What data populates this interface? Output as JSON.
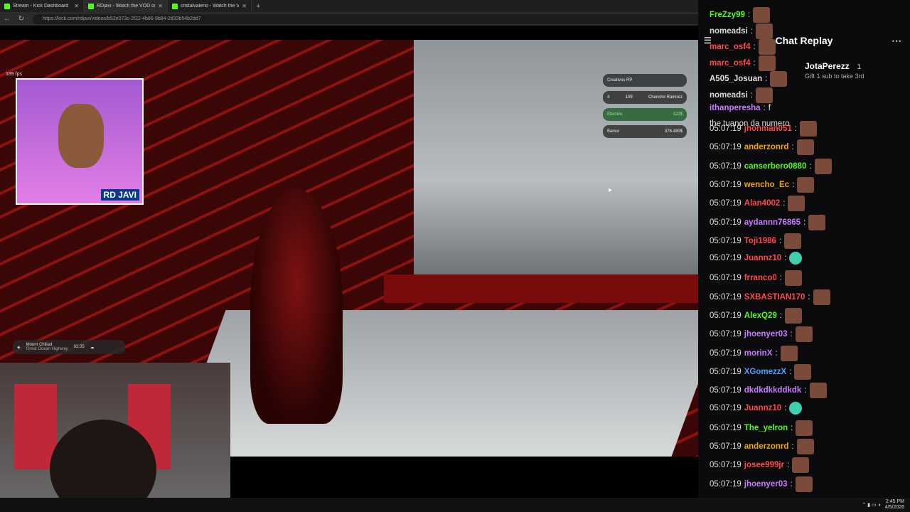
{
  "browser": {
    "tabs": [
      {
        "label": "Stream - Kick Dashboard"
      },
      {
        "label": "RDjavi - Watch the VOD on K"
      },
      {
        "label": "cristalvalerio - Watch the VOD on"
      }
    ],
    "url": "https://kick.com/rdjavi/videos/b52e073c-2f22-4b86-9b84-2d33b54b2dd7"
  },
  "game": {
    "fps": "189 fps",
    "streamer_name": "RD JAVI",
    "hud": {
      "server": "Creativos RP",
      "level": "4",
      "player_id": "109",
      "player_name": "Chencho Ramirez",
      "cash_label": "Efectivo",
      "cash_value": "122$",
      "bank_label": "Banco",
      "bank_value": "376.480$"
    },
    "location": "Mount Chiliad",
    "location_sub": "Great Ocean Highway",
    "time": "02:35"
  },
  "chat": {
    "title": "Chat Replay",
    "gift_user": "JotaPerezz",
    "gift_count": "1",
    "gift_text": "Gift 1 sub to take 3rd",
    "overlay_messages": [
      {
        "user": "FreZzy99",
        "color": "#53fc18"
      },
      {
        "user": "nomeadsi",
        "color": "#d8d8d8"
      },
      {
        "user": "marc_osf4",
        "color": "#ff4a4a"
      },
      {
        "user": "marc_osf4",
        "color": "#ff4a4a"
      },
      {
        "user": "A505_Josuan",
        "color": "#e0e0e0"
      },
      {
        "user": "nomeadsi",
        "color": "#d8d8d8"
      },
      {
        "user": "ithanperesha",
        "color": "#c77dff",
        "text": "f"
      },
      {
        "user": "",
        "color": "#ddd",
        "text": "the tuanon da numero"
      }
    ],
    "messages": [
      {
        "time": "05:07:19",
        "user": "jhonman051",
        "color": "#ff4a4a",
        "text": ""
      },
      {
        "time": "05:07:19",
        "user": "anderzonrd",
        "color": "#f0a500",
        "text": ""
      },
      {
        "time": "05:07:19",
        "user": "canserbero0880",
        "color": "#53fc18",
        "text": ""
      },
      {
        "time": "05:07:19",
        "user": "wencho_Ec",
        "color": "#f0a500",
        "text": ""
      },
      {
        "time": "05:07:19",
        "user": "Alan4002",
        "color": "#ff4a4a",
        "text": ""
      },
      {
        "time": "05:07:19",
        "user": "aydannn76865",
        "color": "#c77dff",
        "text": ""
      },
      {
        "time": "05:07:19",
        "user": "Toji1986",
        "color": "#ff4a4a",
        "text": ""
      },
      {
        "time": "05:07:19",
        "user": "Juannz10",
        "color": "#ff4a4a",
        "text": ""
      },
      {
        "time": "05:07:19",
        "user": "frranco0",
        "color": "#ff4a4a",
        "text": ""
      },
      {
        "time": "05:07:19",
        "user": "SXBASTIAN170",
        "color": "#ff4a4a",
        "text": ""
      },
      {
        "time": "05:07:19",
        "user": "AlexQ29",
        "color": "#53fc18",
        "text": ""
      },
      {
        "time": "05:07:19",
        "user": "jhoenyer03",
        "color": "#c77dff",
        "text": ""
      },
      {
        "time": "05:07:19",
        "user": "morinX",
        "color": "#c77dff",
        "text": ""
      },
      {
        "time": "05:07:19",
        "user": "XGomezzX",
        "color": "#4a9eff",
        "text": ""
      },
      {
        "time": "05:07:19",
        "user": "dkdkdkkddkdk",
        "color": "#c77dff",
        "text": ""
      },
      {
        "time": "05:07:19",
        "user": "Juannz10",
        "color": "#ff4a4a",
        "text": ""
      },
      {
        "time": "05:07:19",
        "user": "The_yelron",
        "color": "#53fc18",
        "text": ""
      },
      {
        "time": "05:07:19",
        "user": "anderzonrd",
        "color": "#f0a500",
        "text": ""
      },
      {
        "time": "05:07:19",
        "user": "josee999jr",
        "color": "#ff4a4a",
        "text": ""
      },
      {
        "time": "05:07:19",
        "user": "jhoenyer03",
        "color": "#c77dff",
        "text": ""
      }
    ]
  },
  "taskbar": {
    "time": "2:45 PM",
    "date": "4/5/2026"
  }
}
